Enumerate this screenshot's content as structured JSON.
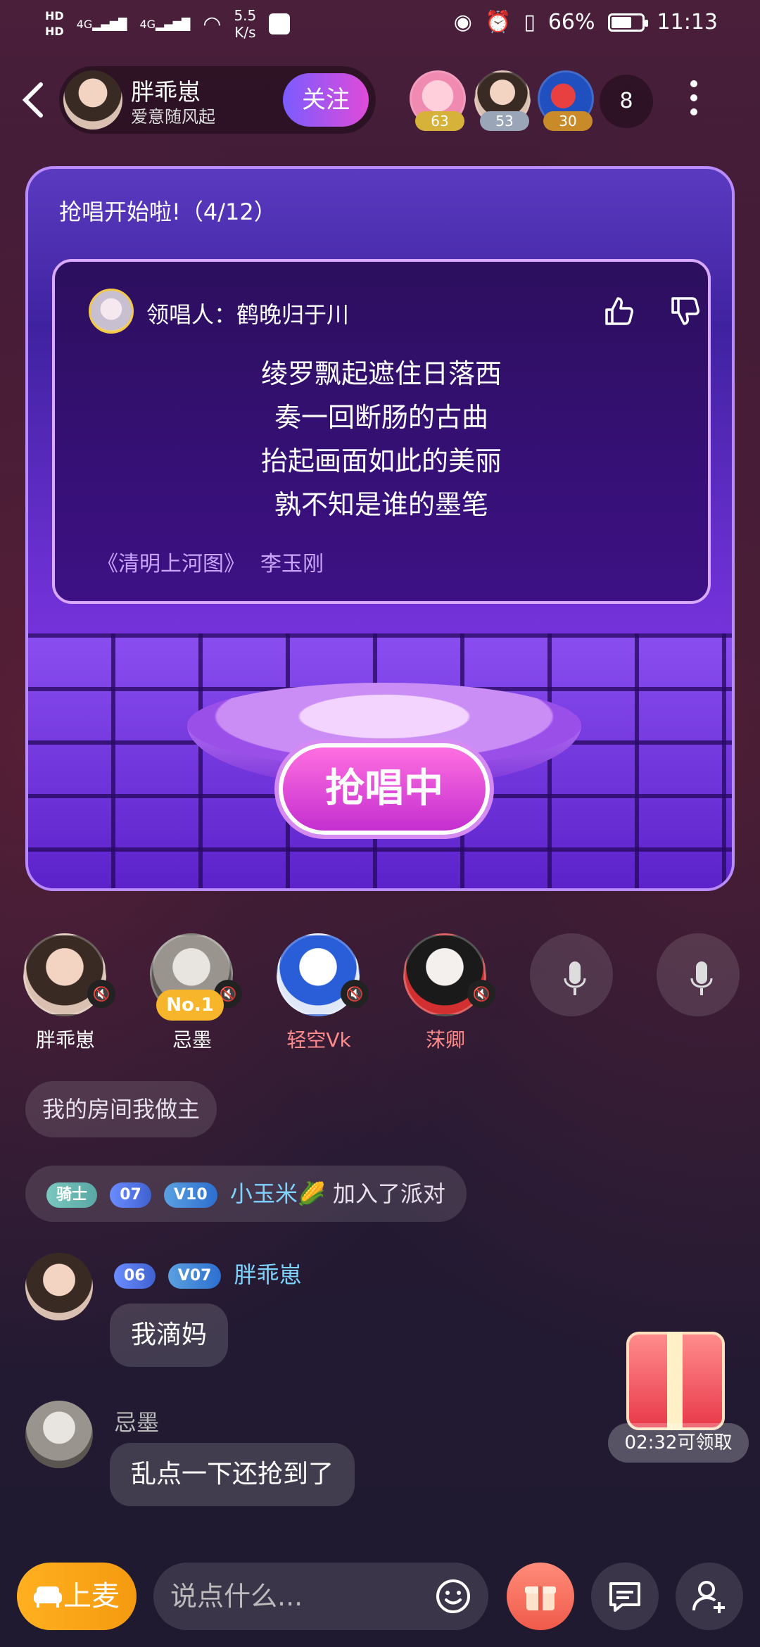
{
  "status_bar": {
    "hd1": "HD",
    "hd2": "HD",
    "net1": "4G",
    "net2": "4G",
    "speed_value": "5.5",
    "speed_unit": "K/s",
    "battery": "66%",
    "battery_level": 0.66,
    "time": "11:13"
  },
  "header": {
    "host_name": "胖乖崽",
    "host_subtitle": "爱意随风起",
    "follow_label": "关注",
    "viewers": [
      {
        "level": "63",
        "level_color": "#d7b23a"
      },
      {
        "level": "53",
        "level_color": "#9aa6b8"
      },
      {
        "level": "30",
        "level_color": "#c98a2a"
      }
    ],
    "viewer_count": "8"
  },
  "stage": {
    "title": "抢唱开始啦!（4/12）",
    "lead_label": "领唱人：鹤晚归于川",
    "lyrics": [
      "绫罗飘起遮住日落西",
      "奏一回断肠的古曲",
      "抬起画面如此的美丽",
      "孰不知是谁的墨笔"
    ],
    "song_title": "《清明上河图》",
    "artist": "李玉刚",
    "grab_label": "抢唱中"
  },
  "seats": [
    {
      "name": "胖乖崽",
      "name_color": "#ffffff",
      "badge": ""
    },
    {
      "name": "忌墨",
      "name_color": "#ffffff",
      "badge": "No.1"
    },
    {
      "name": "轻空Vk",
      "name_color": "#ff8a8a",
      "badge": ""
    },
    {
      "name": "莯卿",
      "name_color": "#ff8a8a",
      "badge": ""
    }
  ],
  "chat": {
    "room_notice": "我的房间我做主",
    "join": {
      "knight_badge": "骑士",
      "level_badge": "07",
      "vip_badge": "V10",
      "user": "小玉米🌽",
      "text": "加入了派对"
    },
    "messages": [
      {
        "level_badge": "06",
        "vip_badge": "V07",
        "user": "胖乖崽",
        "text": "我滴妈"
      },
      {
        "user": "忌墨",
        "text": "乱点一下还抢到了"
      }
    ]
  },
  "gift": {
    "timer_label": "02:32可领取"
  },
  "bottom_bar": {
    "mic_up_label": "上麦",
    "input_placeholder": "说点什么..."
  },
  "colors": {
    "accent_purple": "#b88bff",
    "follow_gradient_start": "#7a5cff",
    "follow_gradient_end": "#e04bd8",
    "mic_up": "#ffb020"
  }
}
